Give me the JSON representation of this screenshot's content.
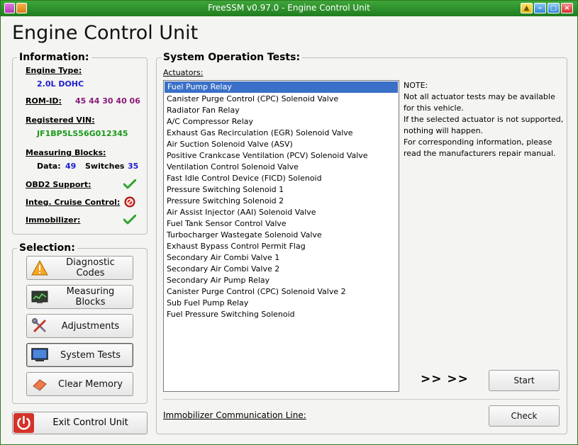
{
  "window": {
    "title": "FreeSSM v0.97.0 - Engine Control Unit"
  },
  "page_title": "Engine Control Unit",
  "information": {
    "title": "Information:",
    "engine_type_label": "Engine Type:",
    "engine_type_value": "2.0L DOHC",
    "rom_id_label": "ROM-ID:",
    "rom_id_value": "45 44 30 40 06",
    "vin_label": "Registered VIN:",
    "vin_value": "JF1BP5LS56G012345",
    "measuring_blocks_label": "Measuring Blocks:",
    "data_label": "Data:",
    "data_value": "49",
    "switches_label": "Switches",
    "switches_value": "35",
    "obd2_label": "OBD2 Support:",
    "cruise_label": "Integ. Cruise Control:",
    "immobilizer_label": "Immobilizer:"
  },
  "selection": {
    "title": "Selection:",
    "buttons": [
      {
        "label": "Diagnostic Codes",
        "icon": "warning-icon"
      },
      {
        "label": "Measuring Blocks",
        "icon": "monitor-graph-icon"
      },
      {
        "label": "Adjustments",
        "icon": "tools-icon"
      },
      {
        "label": "System Tests",
        "icon": "screen-icon"
      },
      {
        "label": "Clear Memory",
        "icon": "eraser-icon"
      }
    ]
  },
  "exit_button": {
    "label": "Exit Control Unit",
    "icon": "power-icon"
  },
  "system_tests": {
    "title": "System Operation Tests:",
    "actuators_label": "Actuators:",
    "actuators": [
      "Fuel Pump Relay",
      "Canister Purge Control (CPC) Solenoid Valve",
      "Radiator Fan Relay",
      "A/C Compressor Relay",
      "Exhaust Gas Recirculation (EGR) Solenoid Valve",
      "Air Suction Solenoid Valve (ASV)",
      "Positive Crankcase Ventilation (PCV) Solenoid Valve",
      "Ventilation Control Solenoid Valve",
      "Fast Idle Control Device (FICD) Solenoid",
      "Pressure Switching Solenoid 1",
      "Pressure Switching Solenoid 2",
      "Air Assist Injector (AAI) Solenoid Valve",
      "Fuel Tank Sensor Control Valve",
      "Turbocharger Wastegate Solenoid Valve",
      "Exhaust Bypass Control Permit Flag",
      "Secondary Air Combi Valve 1",
      "Secondary Air Combi Valve 2",
      "Secondary Air Pump Relay",
      "Canister Purge Control (CPC) Solenoid Valve 2",
      "Sub Fuel Pump Relay",
      "Fuel Pressure Switching Solenoid"
    ],
    "note": {
      "title": "NOTE:",
      "line1": "Not all actuator tests may be available for this vehicle.",
      "line2": "If the selected actuator is not supported, nothing will happen.",
      "line3": "For corresponding information, please read the manufacturers repair manual."
    },
    "arrows": ">> >>",
    "start_label": "Start",
    "immobilizer_line_label": "Immobilizer Communication Line:",
    "check_label": "Check"
  }
}
